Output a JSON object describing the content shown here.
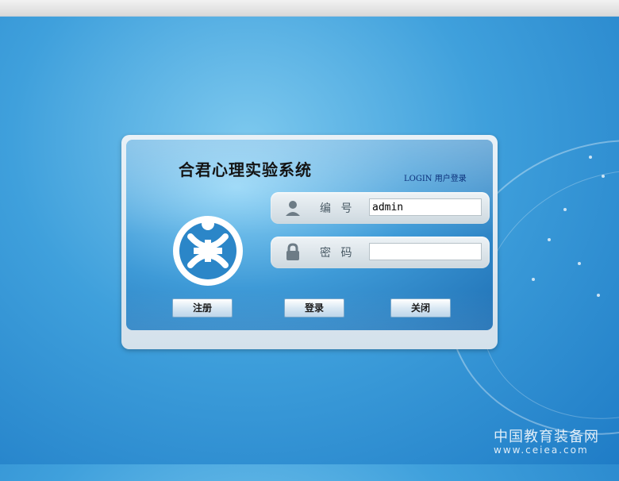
{
  "app": {
    "title": "合君心理实验系统",
    "subtitle": "LOGIN 用户登录"
  },
  "form": {
    "id_label": "编 号",
    "id_value": "admin",
    "password_label": "密 码",
    "password_value": ""
  },
  "buttons": {
    "register": "注册",
    "login": "登录",
    "close": "关闭"
  },
  "watermark": {
    "text": "中国教育装备网",
    "url": "www.ceiea.com"
  },
  "icons": {
    "id": "user-icon",
    "password": "lock-icon",
    "logo": "app-logo"
  },
  "colors": {
    "background": "#3fa0dc",
    "panel": "#e9f1f7",
    "title": "#141414"
  }
}
